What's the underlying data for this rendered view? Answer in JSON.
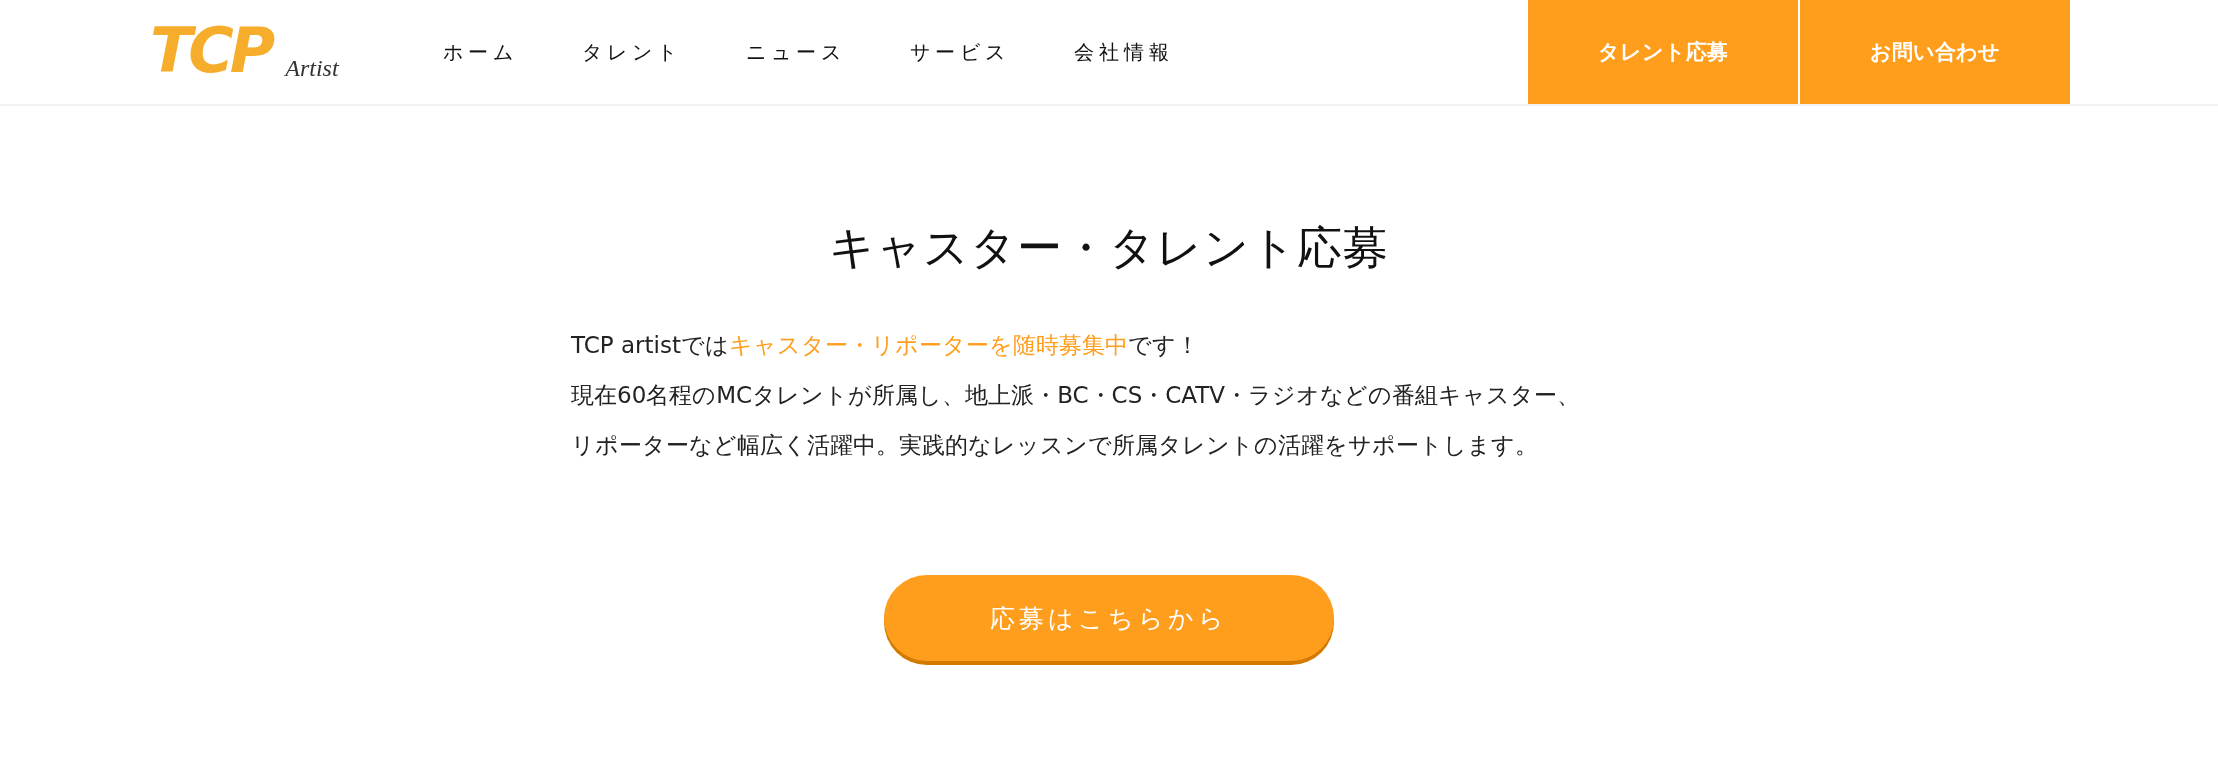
{
  "header": {
    "logo": {
      "mark": "TCP",
      "sub": "Artist"
    },
    "nav": [
      {
        "label": "ホーム"
      },
      {
        "label": "タレント"
      },
      {
        "label": "ニュース"
      },
      {
        "label": "サービス"
      },
      {
        "label": "会社情報"
      }
    ],
    "actions": [
      {
        "label": "タレント応募"
      },
      {
        "label": "お問い合わせ"
      }
    ]
  },
  "main": {
    "title": "キャスター・タレント応募",
    "paragraph": [
      [
        {
          "text": "TCP artistでは",
          "highlight": false
        },
        {
          "text": "キャスター・リポーターを随時募集中",
          "highlight": true
        },
        {
          "text": "です！",
          "highlight": false
        }
      ],
      [
        {
          "text": "現在60名程のMCタレントが所属し、地上派・BC・CS・CATV・ラジオなどの番組キャスター、",
          "highlight": false
        }
      ],
      [
        {
          "text": "リポーターなど幅広く活躍中。実践的なレッスンで所属タレントの活躍をサポートします。",
          "highlight": false
        }
      ]
    ],
    "button": "応募はこちらから"
  }
}
